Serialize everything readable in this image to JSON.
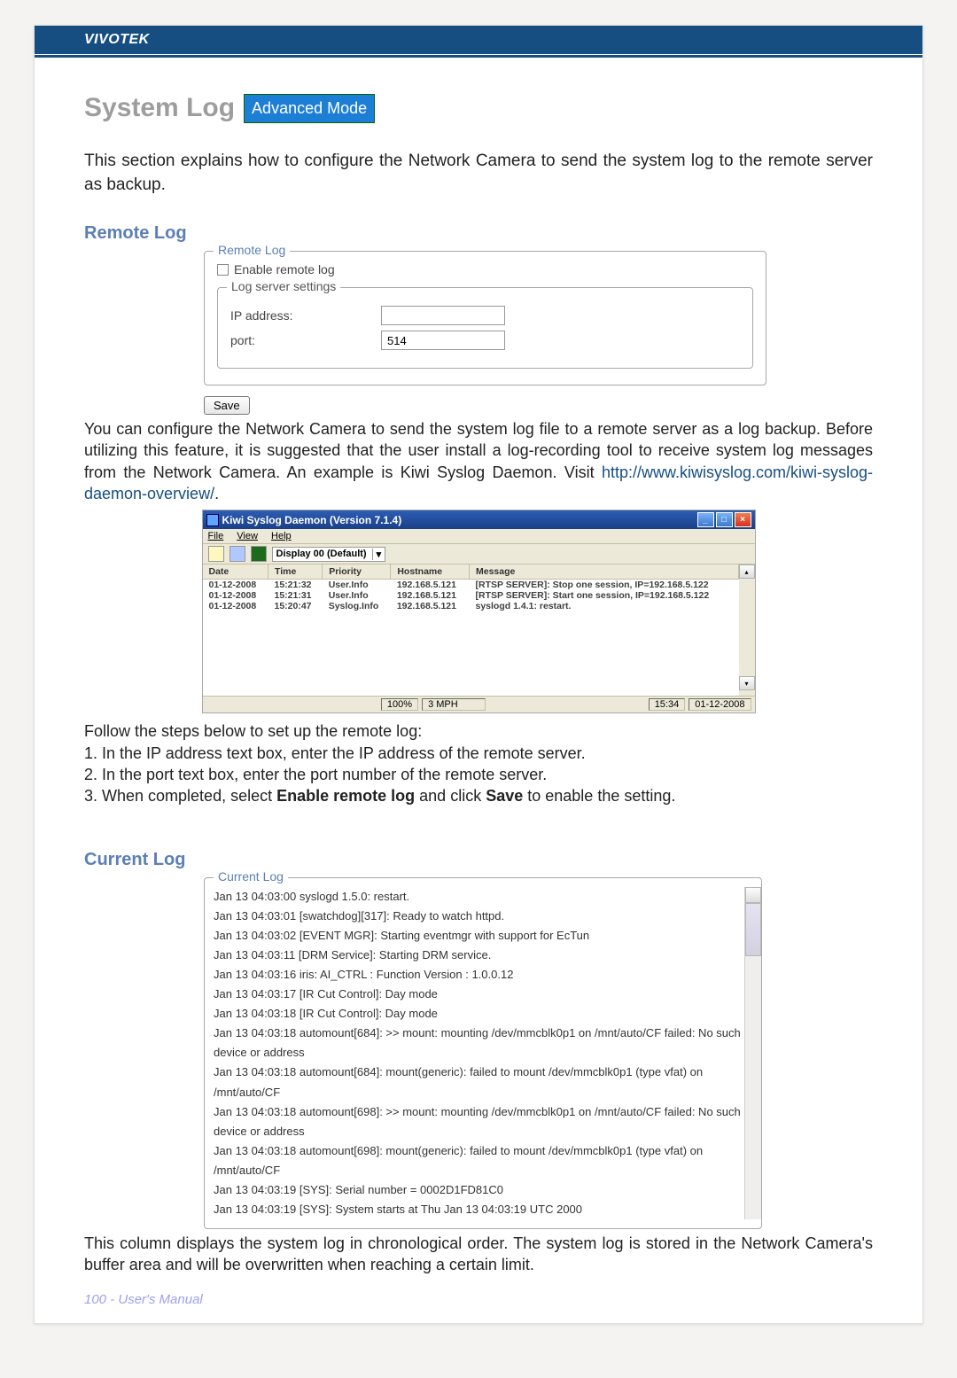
{
  "brand": "VIVOTEK",
  "title": "System Log",
  "badge": "Advanced Mode",
  "intro": "This section explains how to configure the Network Camera to send the system log to the remote server as backup.",
  "remote": {
    "heading": "Remote Log",
    "fieldset_legend": "Remote Log",
    "enable_label": "Enable remote log",
    "inner_legend": "Log server settings",
    "ip_label": "IP address:",
    "ip_value": "",
    "port_label": "port:",
    "port_value": "514",
    "save_label": "Save",
    "desc_pre": "You can configure the Network Camera to send the system log file to a remote server as a log backup. Before utilizing this feature, it is suggested that the user install a log-recording tool to receive system log messages from the Network Camera. An example is Kiwi Syslog Daemon. Visit ",
    "desc_link": "http://www.kiwisyslog.com/kiwi-syslog-daemon-overview/",
    "desc_post": "."
  },
  "kiwi": {
    "title": "Kiwi Syslog Daemon (Version 7.1.4)",
    "menus": {
      "m1": "File",
      "m2": "View",
      "m3": "Help"
    },
    "display_label": "Display 00 (Default)",
    "headers": {
      "c1": "Date",
      "c2": "Time",
      "c3": "Priority",
      "c4": "Hostname",
      "c5": "Message"
    },
    "rows": [
      {
        "c1": "01-12-2008",
        "c2": "15:21:32",
        "c3": "User.Info",
        "c4": "192.168.5.121",
        "c5": "[RTSP SERVER]: Stop one session, IP=192.168.5.122"
      },
      {
        "c1": "01-12-2008",
        "c2": "15:21:31",
        "c3": "User.Info",
        "c4": "192.168.5.121",
        "c5": "[RTSP SERVER]: Start one session, IP=192.168.5.122"
      },
      {
        "c1": "01-12-2008",
        "c2": "15:20:47",
        "c3": "Syslog.Info",
        "c4": "192.168.5.121",
        "c5": "syslogd 1.4.1: restart."
      }
    ],
    "status": {
      "pct": "100%",
      "mph": "3 MPH",
      "time": "15:34",
      "date": "01-12-2008"
    }
  },
  "steps": {
    "s0": "Follow the steps below to set up the remote log:",
    "s1": "1. In the IP address text box, enter the IP address of the remote server.",
    "s2": "2. In the port text box, enter the port number of the remote server.",
    "s3a": "3. When completed, select ",
    "s3b": "Enable remote log",
    "s3c": " and click ",
    "s3d": "Save",
    "s3e": " to enable the setting."
  },
  "current": {
    "heading": "Current Log",
    "legend": "Current Log",
    "lines": {
      "l0": "Jan 13 04:03:00 syslogd 1.5.0: restart.",
      "l1": "Jan 13 04:03:01 [swatchdog][317]: Ready to watch httpd.",
      "l2": "Jan 13 04:03:02 [EVENT MGR]: Starting eventmgr with support for EcTun",
      "l3": "Jan 13 04:03:11 [DRM Service]: Starting DRM service.",
      "l4": "Jan 13 04:03:16 iris: AI_CTRL : Function Version : 1.0.0.12",
      "l5": "Jan 13 04:03:17 [IR Cut Control]: Day mode",
      "l6": "Jan 13 04:03:18 [IR Cut Control]: Day mode",
      "l7": "Jan 13 04:03:18 automount[684]: >> mount: mounting /dev/mmcblk0p1 on /mnt/auto/CF failed: No such device or address",
      "l8": "Jan 13 04:03:18 automount[684]: mount(generic): failed to mount /dev/mmcblk0p1 (type vfat) on /mnt/auto/CF",
      "l9": "Jan 13 04:03:18 automount[698]: >> mount: mounting /dev/mmcblk0p1 on /mnt/auto/CF failed: No such device or address",
      "l10": "Jan 13 04:03:18 automount[698]: mount(generic): failed to mount /dev/mmcblk0p1 (type vfat) on /mnt/auto/CF",
      "l11": "Jan 13 04:03:19 [SYS]: Serial number = 0002D1FD81C0",
      "l12": "Jan 13 04:03:19 [SYS]: System starts at Thu Jan 13 04:03:19 UTC 2000"
    },
    "desc": "This column displays the system log in chronological order. The system log is stored in the Network Camera's buffer area and will be overwritten when reaching a certain limit."
  },
  "footer": "100 - User's Manual"
}
